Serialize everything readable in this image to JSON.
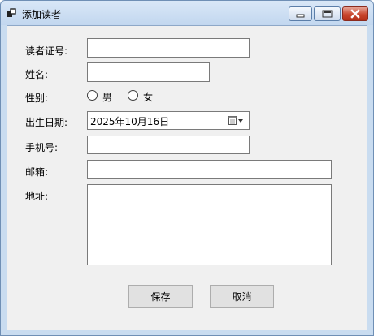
{
  "window": {
    "title": "添加读者",
    "buttons": {
      "minimize": "minimize-icon",
      "maximize": "maximize-icon",
      "close": "close-icon"
    }
  },
  "form": {
    "reader_id": {
      "label": "读者证号:",
      "value": ""
    },
    "name": {
      "label": "姓名:",
      "value": ""
    },
    "gender": {
      "label": "性别:",
      "options": [
        "男",
        "女"
      ],
      "selected": null
    },
    "birth_date": {
      "label": "出生日期:",
      "value": "2025年10月16日"
    },
    "phone": {
      "label": "手机号:",
      "value": ""
    },
    "email": {
      "label": "邮箱:",
      "value": ""
    },
    "address": {
      "label": "地址:",
      "value": ""
    }
  },
  "actions": {
    "save_label": "保存",
    "cancel_label": "取消"
  },
  "colors": {
    "title_bar": "#c9dcf0",
    "client_bg": "#f0f0f0",
    "close_button": "#c9472e"
  }
}
